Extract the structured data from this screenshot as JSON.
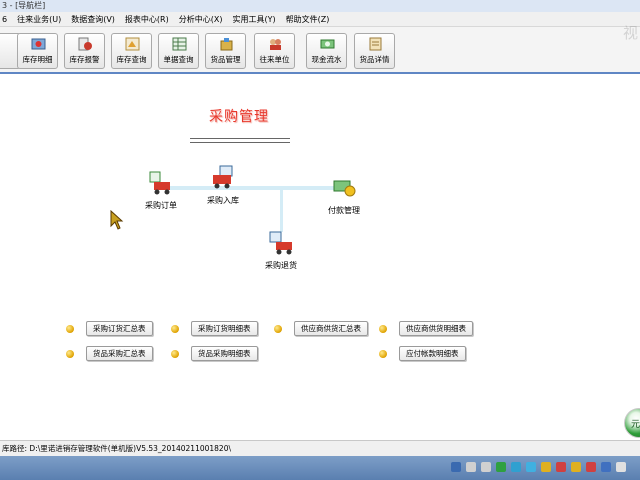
{
  "window": {
    "title": "3 - [导航栏]"
  },
  "menu": [
    "往来业务(U)",
    "数据查询(V)",
    "报表中心(R)",
    "分析中心(X)",
    "实用工具(Y)",
    "帮助文件(Z)"
  ],
  "menu_first_partial": "6",
  "toolbar": [
    {
      "label": "库存明细",
      "icon": "inventory-detail-icon"
    },
    {
      "label": "库存报警",
      "icon": "stock-alarm-icon"
    },
    {
      "label": "库存查询",
      "icon": "stock-query-icon"
    },
    {
      "label": "单据查询",
      "icon": "document-query-icon"
    },
    {
      "label": "货品管理",
      "icon": "goods-management-icon"
    },
    {
      "label": "往来单位",
      "icon": "contacts-icon"
    },
    {
      "label": "现金流水",
      "icon": "cash-flow-icon"
    },
    {
      "label": "货品详情",
      "icon": "goods-detail-icon"
    }
  ],
  "section": {
    "title": "采购管理"
  },
  "flow": [
    {
      "label": "采购订单",
      "icon": "purchase-order-icon"
    },
    {
      "label": "采购入库",
      "icon": "purchase-receipt-icon"
    },
    {
      "label": "付款管理",
      "icon": "payment-management-icon"
    },
    {
      "label": "采购退货",
      "icon": "purchase-return-icon"
    }
  ],
  "reports": [
    "采购订货汇总表",
    "采购订货明细表",
    "供应商供货汇总表",
    "供应商供货明细表",
    "货品采购汇总表",
    "货品采购明细表",
    "应付帐款明细表"
  ],
  "status": {
    "path": "库路径: D:\\里诺进销存管理软件(单机版)V5.53_20140211001820\\"
  },
  "watermark": "视",
  "corner_text": "元"
}
